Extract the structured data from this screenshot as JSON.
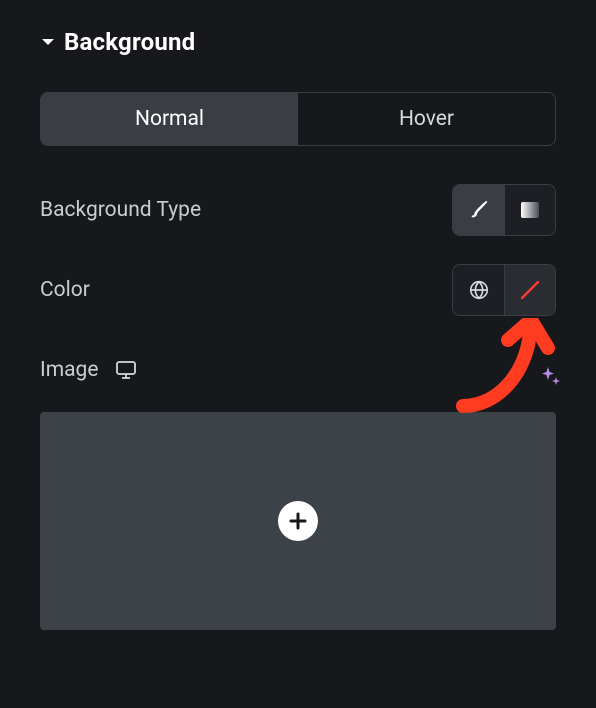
{
  "section": {
    "title": "Background"
  },
  "tabs": {
    "normal": "Normal",
    "hover": "Hover"
  },
  "rows": {
    "backgroundType": "Background Type",
    "color": "Color",
    "image": "Image"
  },
  "backgroundType": {
    "options": [
      "classic",
      "gradient"
    ],
    "selected": "classic"
  },
  "colorSwatch": {
    "value": "none",
    "display": "no-color"
  },
  "annotations": {
    "arrowTarget": "color-swatch"
  }
}
